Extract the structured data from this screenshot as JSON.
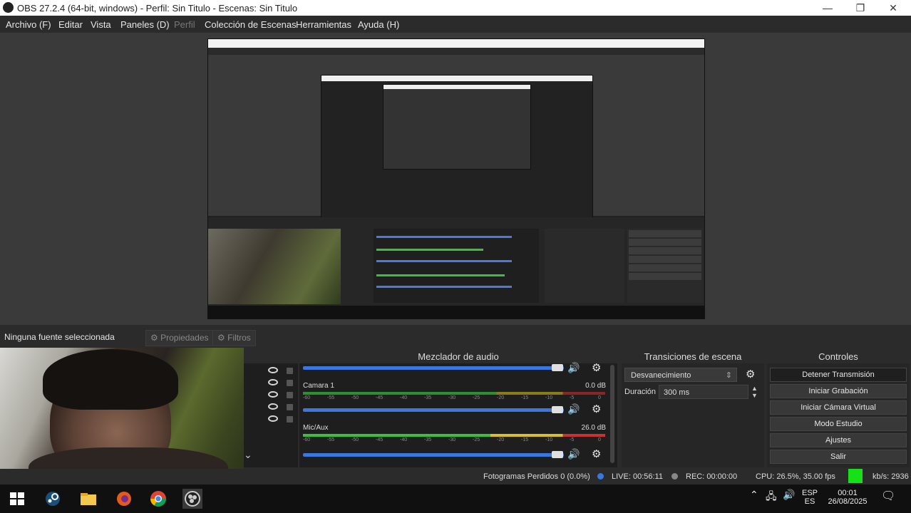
{
  "window": {
    "title": "OBS 27.2.4 (64-bit, windows) - Perfil: Sin Titulo - Escenas: Sin Titulo",
    "minimize": "—",
    "maximize": "❐",
    "close": "✕"
  },
  "menu": {
    "items": [
      "Archivo (F)",
      "Editar",
      "Vista",
      "Paneles (D)",
      "Perfil",
      "Colección de Escenas",
      "Herramientas",
      "Ayuda (H)"
    ]
  },
  "source_toolbar": {
    "no_source": "Ninguna fuente seleccionada",
    "properties": "Propiedades",
    "filters": "Filtros"
  },
  "panels": {
    "mixer": "Mezclador de audio",
    "transitions": "Transiciones de escena",
    "controls": "Controles"
  },
  "mixer": {
    "channels": [
      {
        "name": "Camara 1",
        "db": "0.0 dB"
      },
      {
        "name": "Mic/Aux",
        "db": "26.0 dB"
      }
    ],
    "ticks": [
      "-60",
      "-55",
      "-50",
      "-45",
      "-40",
      "-35",
      "-30",
      "-25",
      "-20",
      "-15",
      "-10",
      "-5",
      "0"
    ]
  },
  "transitions": {
    "selected": "Desvanecimiento",
    "duration_label": "Duración",
    "duration_value": "300 ms"
  },
  "controls": {
    "buttons": [
      "Detener Transmisión",
      "Iniciar Grabación",
      "Iniciar Cámara Virtual",
      "Modo Estudio",
      "Ajustes",
      "Salir"
    ]
  },
  "status": {
    "dropped": "Fotogramas Perdidos 0 (0.0%)",
    "live": "LIVE: 00:56:11",
    "rec": "REC: 00:00:00",
    "cpu": "CPU: 26.5%, 35.00 fps",
    "kbs": "kb/s: 2936"
  },
  "taskbar": {
    "lang_top": "ESP",
    "lang_bottom": "ES",
    "time": "00:01",
    "date": "26/08/2025"
  },
  "colors": {
    "accent_blue": "#3a78e0",
    "meter_green": "#3cbf3c",
    "meter_yellow": "#d8c02a",
    "meter_red": "#c83232",
    "stream_ok": "#18e018"
  }
}
